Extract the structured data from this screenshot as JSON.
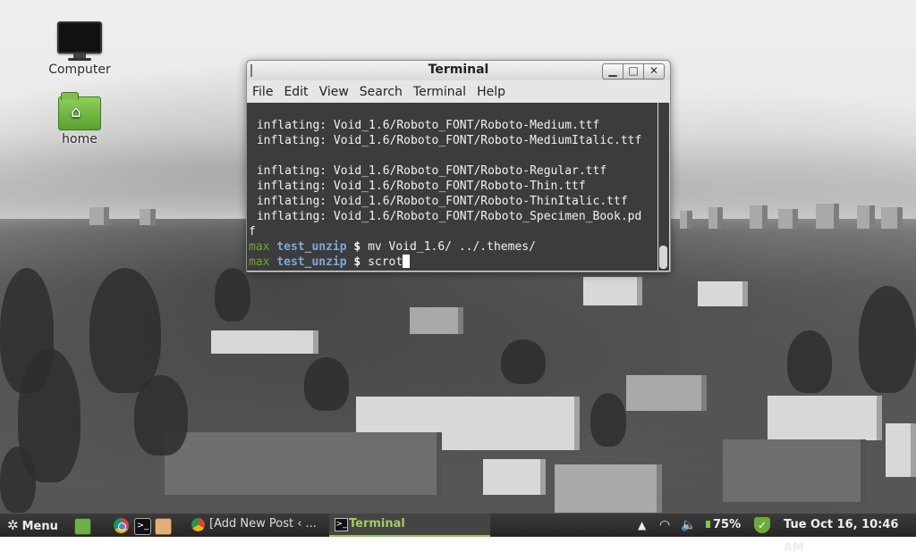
{
  "desktop": {
    "icons": [
      {
        "label": "Computer",
        "icon": "computer-icon"
      },
      {
        "label": "home",
        "icon": "home-folder-icon"
      }
    ]
  },
  "terminal": {
    "title": "Terminal",
    "menu": [
      "File",
      "Edit",
      "View",
      "Search",
      "Terminal",
      "Help"
    ],
    "lines": [
      " inflating: Void_1.6/Roboto_FONT/Roboto-Medium.ttf",
      " inflating: Void_1.6/Roboto_FONT/Roboto-MediumItalic.ttf",
      "",
      " inflating: Void_1.6/Roboto_FONT/Roboto-Regular.ttf",
      " inflating: Void_1.6/Roboto_FONT/Roboto-Thin.ttf",
      " inflating: Void_1.6/Roboto_FONT/Roboto-ThinItalic.ttf",
      " inflating: Void_1.6/Roboto_FONT/Roboto_Specimen_Book.pd",
      "f"
    ],
    "prompts": [
      {
        "user": "max",
        "dir": "test_unzip",
        "symbol": "$",
        "command": "mv Void_1.6/ ../.themes/"
      },
      {
        "user": "max",
        "dir": "test_unzip",
        "symbol": "$",
        "command": "scrot"
      }
    ]
  },
  "panel": {
    "menu_label": "Menu",
    "tasks": [
      {
        "label": "[Add New Post ‹ ...",
        "icon": "chrome-icon"
      },
      {
        "label": "Terminal",
        "icon": "terminal-icon",
        "active": true
      }
    ],
    "battery": "75%",
    "clock": "Tue Oct 16, 10:46 AM"
  },
  "colors": {
    "prompt_user": "#6fa62f",
    "prompt_dir": "#7fa8d6",
    "terminal_bg": "#3c3c3c",
    "accent": "#8bc34a"
  }
}
